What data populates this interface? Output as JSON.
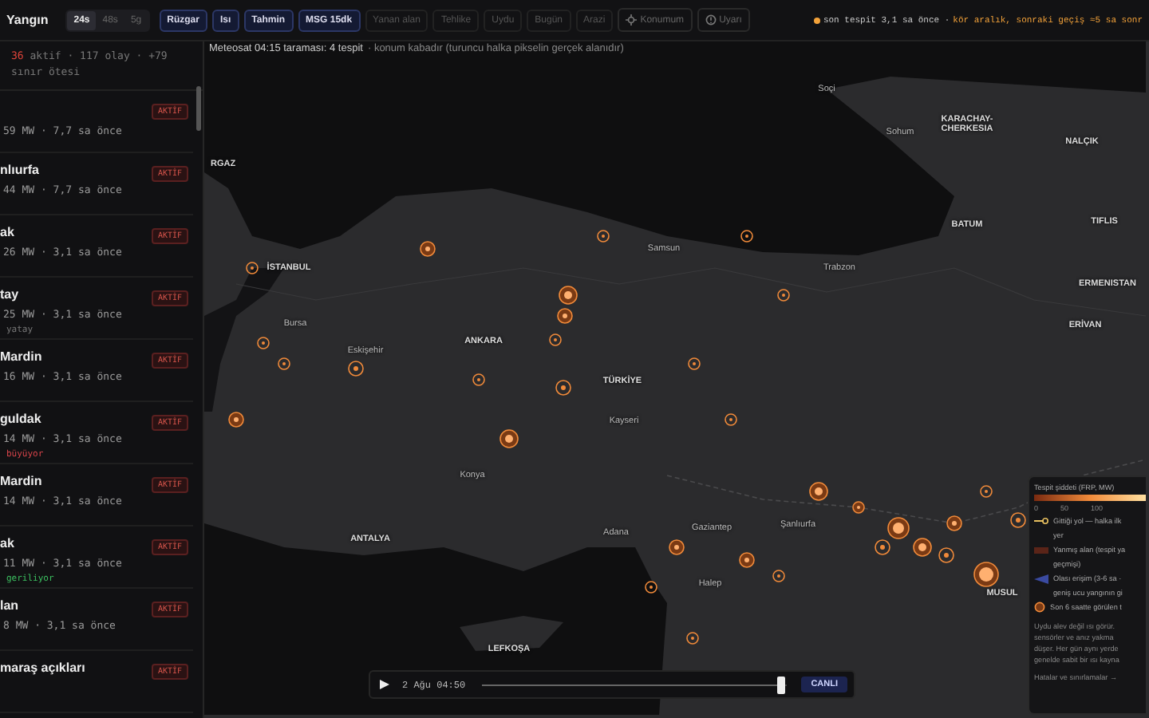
{
  "app": {
    "title": "Yangın"
  },
  "ranges": [
    {
      "label": "24s",
      "selected": true
    },
    {
      "label": "48s",
      "selected": false
    },
    {
      "label": "5g",
      "selected": false
    }
  ],
  "layers": [
    {
      "label": "Rüzgar",
      "on": true
    },
    {
      "label": "Isı",
      "on": true
    },
    {
      "label": "Tahmin",
      "on": true
    },
    {
      "label": "MSG 15dk",
      "on": true
    },
    {
      "label": "Yanan alan",
      "on": false
    },
    {
      "label": "Tehlike",
      "on": false
    },
    {
      "label": "Uydu",
      "on": false
    },
    {
      "label": "Bugün",
      "on": false
    },
    {
      "label": "Arazi",
      "on": false
    }
  ],
  "actions": [
    {
      "kind": "locate",
      "label": "Konumum"
    },
    {
      "kind": "alert",
      "label": "Uyarı"
    }
  ],
  "status": {
    "last": "son tespit 3,1 sa önce ·",
    "warning": "kör aralık, sonraki geçiş ≈5 sa sonr"
  },
  "scan": {
    "title": "Meteosat 04:15 taraması: 4 tespit",
    "note": "· konum kabadır (turuncu halka pikselin gerçek alanıdır)"
  },
  "summary": {
    "active": "36",
    "rest": "aktif · 117 olay · +79 sınır ötesi"
  },
  "fires": [
    {
      "meta": "59 MW · 7,7 sa önce",
      "badge": "AKTİF"
    },
    {
      "name": "nlıurfa",
      "meta": "44 MW · 7,7 sa önce",
      "badge": "AKTİF"
    },
    {
      "name": "ak",
      "meta": "26 MW · 3,1 sa önce",
      "badge": "AKTİF"
    },
    {
      "name": "tay",
      "meta": "25 MW · 3,1 sa önce",
      "badge": "AKTİF",
      "trend": {
        "kind": "flat",
        "label": "yatay"
      }
    },
    {
      "name": "Mardin",
      "meta": "16 MW · 3,1 sa önce",
      "badge": "AKTİF"
    },
    {
      "name": "guldak",
      "meta": "14 MW · 3,1 sa önce",
      "badge": "AKTİF",
      "trend": {
        "kind": "grow",
        "label": "büyüyor"
      }
    },
    {
      "name": "Mardin",
      "meta": "14 MW · 3,1 sa önce",
      "badge": "AKTİF"
    },
    {
      "name": "ak",
      "meta": "11 MW · 3,1 sa önce",
      "badge": "AKTİF",
      "trend": {
        "kind": "shrink",
        "label": "geriliyor"
      }
    },
    {
      "name": "lan",
      "meta": "8 MW · 3,1 sa önce",
      "badge": "AKTİF"
    },
    {
      "name": "maraş açıkları",
      "badge": "AKTİF"
    }
  ],
  "cities": [
    "Soçi",
    "KARACHAY-CHERKESIA",
    "NALÇIK",
    "Sohum",
    "BATUM",
    "TIFLIS",
    "ERMENISTAN",
    "ERİVAN",
    "Samsun",
    "Trabzon",
    "İSTANBUL",
    "Bursa",
    "Eskişehir",
    "ANKARA",
    "TÜRKİYE",
    "Kayseri",
    "Konya",
    "Adana",
    "Gaziantep",
    "Şanlıurfa",
    "MUSUL",
    "ANTALYA",
    "Halep",
    "LEFKOŞA",
    "RGAZ"
  ],
  "legend": {
    "title": "Tespit şiddeti (FRP, MW)",
    "ticks": [
      "0",
      "50",
      "100"
    ],
    "rows": [
      {
        "kind": "path",
        "text": "Gittiği yol — halka ilk"
      },
      {
        "kind": "path_more",
        "text": "yer"
      },
      {
        "kind": "burned",
        "text": "Yanmış alan (tespit ya"
      },
      {
        "kind": "burned_more",
        "text": "geçmişi)"
      },
      {
        "kind": "reach",
        "text": "Olası erişim (3-6 sa ·"
      },
      {
        "kind": "reach_more",
        "text": "geniş ucu yangının gi"
      },
      {
        "kind": "recent",
        "text": "Son 6 saatte görülen t"
      }
    ],
    "note": [
      "Uydu alev değil ısı görür.",
      "sensörler ve anız yakma",
      "düşer. Her gün aynı yerde",
      "genelde sabit bir ısı kayna"
    ],
    "link": "Hatalar ve sınırlamalar →"
  },
  "timeline": {
    "time": "2 Ağu 04:50",
    "level": 0.98,
    "live": "CANLI"
  }
}
